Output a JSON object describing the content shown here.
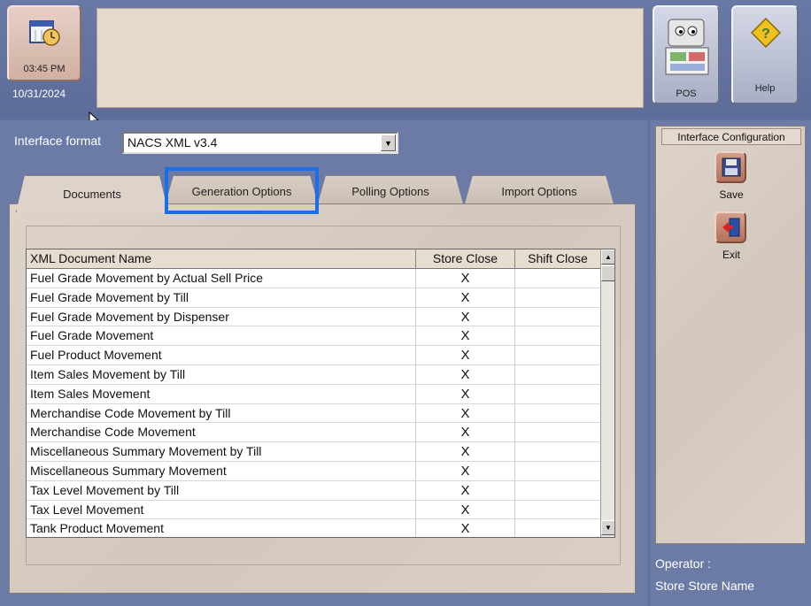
{
  "header": {
    "clock_time": "03:45 PM",
    "date": "10/31/2024",
    "pos_label": "POS",
    "help_label": "Help"
  },
  "interface_format": {
    "label": "Interface format",
    "value": "NACS XML v3.4"
  },
  "tabs": [
    {
      "label": "Documents",
      "active": true
    },
    {
      "label": "Generation Options",
      "active": false,
      "highlighted": true
    },
    {
      "label": "Polling Options",
      "active": false
    },
    {
      "label": "Import Options",
      "active": false
    }
  ],
  "grid": {
    "columns": [
      "XML Document Name",
      "Store Close",
      "Shift Close"
    ],
    "rows": [
      {
        "name": "Fuel Grade Movement by Actual Sell Price",
        "store": "X",
        "shift": ""
      },
      {
        "name": "Fuel Grade Movement by Till",
        "store": "X",
        "shift": ""
      },
      {
        "name": "Fuel Grade Movement by Dispenser",
        "store": "X",
        "shift": ""
      },
      {
        "name": "Fuel Grade Movement",
        "store": "X",
        "shift": ""
      },
      {
        "name": "Fuel Product Movement",
        "store": "X",
        "shift": ""
      },
      {
        "name": "Item Sales Movement by Till",
        "store": "X",
        "shift": ""
      },
      {
        "name": "Item Sales Movement",
        "store": "X",
        "shift": ""
      },
      {
        "name": "Merchandise Code Movement by Till",
        "store": "X",
        "shift": ""
      },
      {
        "name": "Merchandise Code Movement",
        "store": "X",
        "shift": ""
      },
      {
        "name": "Miscellaneous Summary Movement by Till",
        "store": "X",
        "shift": ""
      },
      {
        "name": "Miscellaneous Summary Movement",
        "store": "X",
        "shift": ""
      },
      {
        "name": "Tax Level Movement by Till",
        "store": "X",
        "shift": ""
      },
      {
        "name": "Tax Level Movement",
        "store": "X",
        "shift": ""
      },
      {
        "name": "Tank Product Movement",
        "store": "X",
        "shift": ""
      }
    ]
  },
  "side_panel": {
    "title": "Interface Configuration",
    "save_label": "Save",
    "exit_label": "Exit"
  },
  "footer": {
    "operator": "Operator :",
    "store": "Store Store Name"
  },
  "colors": {
    "background": "#5f6f9c",
    "panel": "#ddd3c9",
    "highlight": "#1a6fe8"
  }
}
